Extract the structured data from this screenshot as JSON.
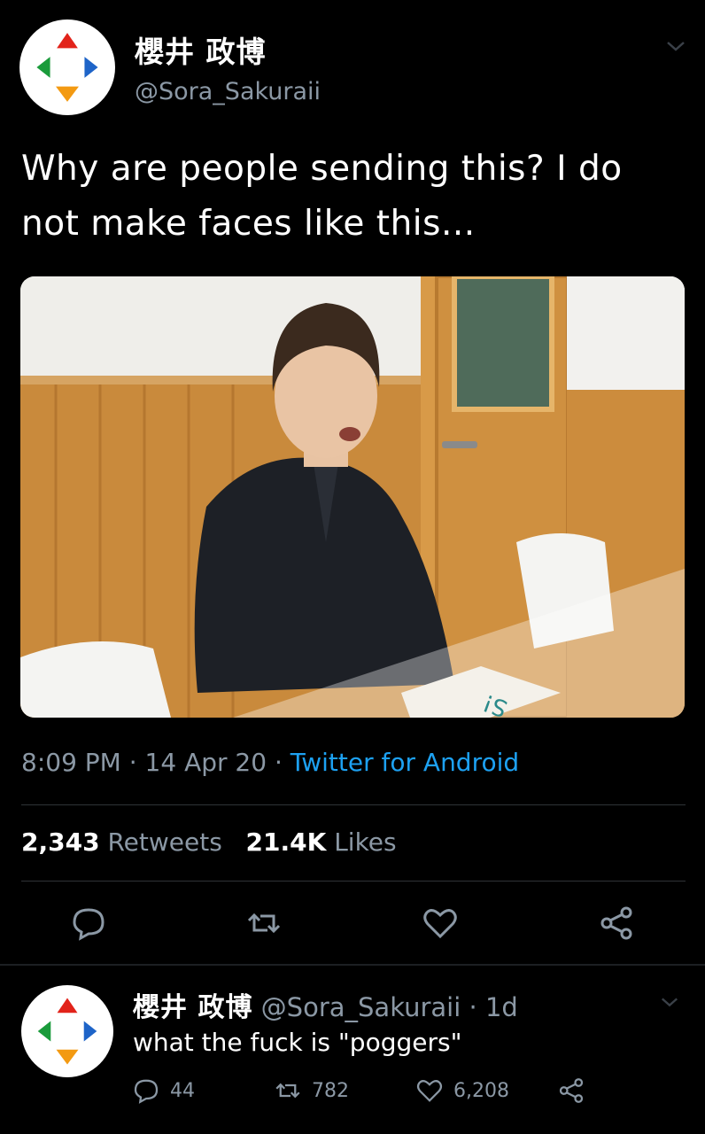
{
  "tweet": {
    "display_name": "櫻井 政博",
    "handle": "@Sora_Sakuraii",
    "text": "Why are people sending this? I do not make faces like this...",
    "time": "8:09 PM",
    "date": "14 Apr 20",
    "source": "Twitter for Android",
    "retweets_count": "2,343",
    "retweets_label": "Retweets",
    "likes_count": "21.4K",
    "likes_label": "Likes",
    "media_icons": {
      "reply": "reply-icon",
      "retweet": "retweet-icon",
      "like": "heart-icon",
      "share": "share-icon"
    }
  },
  "reply_tweet": {
    "display_name": "櫻井 政博",
    "handle": "@Sora_Sakuraii",
    "age": "1d",
    "text": "what the fuck is \"poggers\"",
    "reply_count": "44",
    "retweet_count": "782",
    "like_count": "6,208"
  },
  "colors": {
    "background": "#000000",
    "muted": "#8b98a5",
    "link": "#1da1f2",
    "avatar_red": "#e2231a",
    "avatar_green": "#1a9b3b",
    "avatar_blue": "#1e64c8",
    "avatar_orange": "#f39a12"
  }
}
